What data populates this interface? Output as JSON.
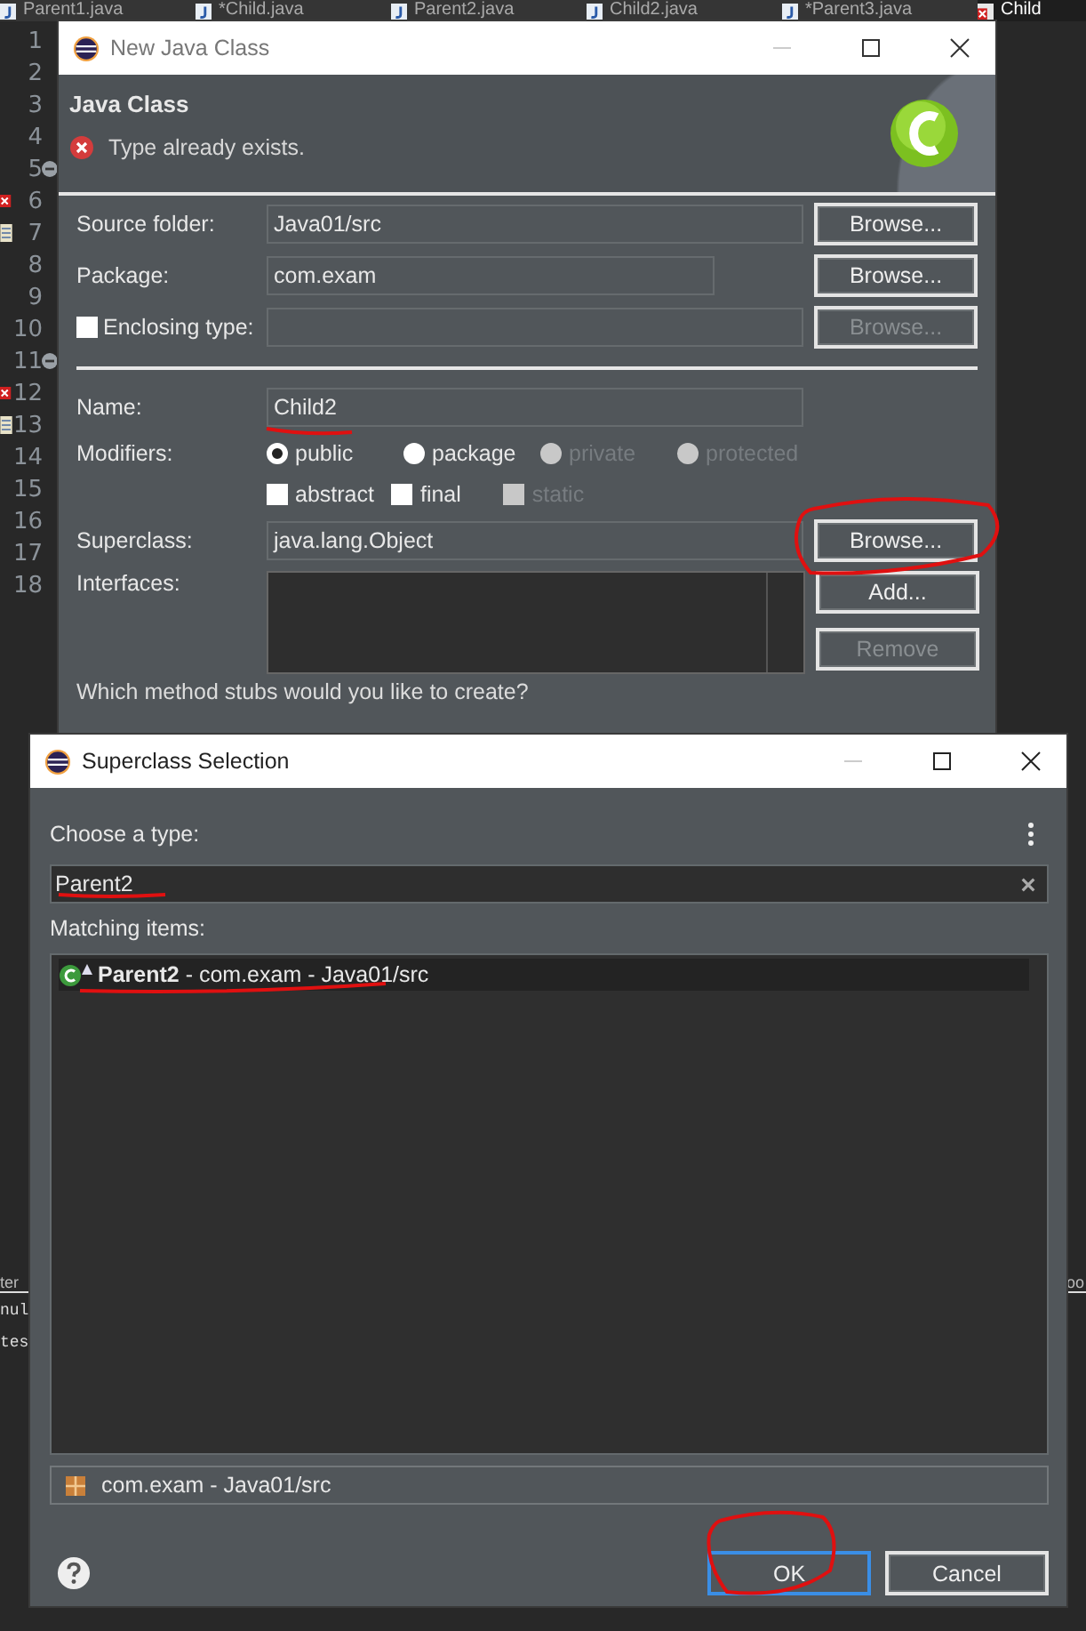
{
  "editor_tabs": [
    {
      "label": "Parent1.java",
      "error": false,
      "selected": false
    },
    {
      "label": "*Child.java",
      "error": false,
      "selected": false
    },
    {
      "label": "Parent2.java",
      "error": false,
      "selected": false
    },
    {
      "label": "Child2.java",
      "error": false,
      "selected": false
    },
    {
      "label": "*Parent3.java",
      "error": false,
      "selected": false
    },
    {
      "label": "Child",
      "error": true,
      "selected": true
    }
  ],
  "gutter": {
    "lines": [
      {
        "number": "1"
      },
      {
        "number": "2"
      },
      {
        "number": "3"
      },
      {
        "number": "4"
      },
      {
        "number": "5",
        "kind": "fold"
      },
      {
        "number": "6",
        "kind": "error"
      },
      {
        "number": "7",
        "kind": "note"
      },
      {
        "number": "8"
      },
      {
        "number": "9"
      },
      {
        "number": "10"
      },
      {
        "number": "11",
        "kind": "fold"
      },
      {
        "number": "12",
        "kind": "error"
      },
      {
        "number": "13",
        "kind": "note"
      },
      {
        "number": "14"
      },
      {
        "number": "15"
      },
      {
        "number": "16"
      },
      {
        "number": "17"
      },
      {
        "number": "18"
      }
    ]
  },
  "console_fragments": {
    "left": [
      "ter",
      "nul",
      "tes"
    ],
    "right": [
      "oo"
    ]
  },
  "new_class_dialog": {
    "title": "New Java Class",
    "header_title": "Java Class",
    "message": {
      "kind": "error",
      "text": "Type already exists."
    },
    "fields": [
      {
        "kind": "field",
        "label": "Source folder:",
        "value": "Java01/src",
        "button": {
          "label": "Browse...",
          "disabled": false
        }
      },
      {
        "kind": "short",
        "label": "Package:",
        "value": "com.exam",
        "button": {
          "label": "Browse...",
          "disabled": false
        }
      },
      {
        "kind": "check",
        "label": "Enclosing type:",
        "checked": false,
        "button": {
          "label": "Browse...",
          "disabled": true
        }
      }
    ],
    "name": {
      "label": "Name:",
      "value": "Child2"
    },
    "modifiers": {
      "label": "Modifiers:",
      "access": [
        {
          "label": "public",
          "selected": true,
          "disabled": false
        },
        {
          "label": "package",
          "selected": false,
          "disabled": false
        },
        {
          "label": "private",
          "selected": false,
          "disabled": true
        },
        {
          "label": "protected",
          "selected": false,
          "disabled": true
        }
      ],
      "flags": [
        {
          "label": "abstract",
          "checked": false,
          "disabled": false
        },
        {
          "label": "final",
          "checked": false,
          "disabled": false
        },
        {
          "label": "static",
          "checked": false,
          "disabled": true
        }
      ]
    },
    "superclass": {
      "label": "Superclass:",
      "value": "java.lang.Object",
      "button": {
        "label": "Browse...",
        "disabled": false
      }
    },
    "interfaces": {
      "label": "Interfaces:",
      "buttons": [
        {
          "label": "Add...",
          "disabled": false
        },
        {
          "label": "Remove",
          "disabled": true
        }
      ]
    },
    "stubs_question": "Which method stubs would you like to create?"
  },
  "superclass_dialog": {
    "title": "Superclass Selection",
    "prompt": "Choose a type:",
    "search_value": "Parent2",
    "matching_label": "Matching items:",
    "items": [
      {
        "text": "**Parent2** - com.exam - Java01/src",
        "selected": true
      }
    ],
    "status": "com.exam - Java01/src",
    "buttons": [
      {
        "label": "OK",
        "default": true
      },
      {
        "label": "Cancel",
        "default": false
      }
    ]
  }
}
